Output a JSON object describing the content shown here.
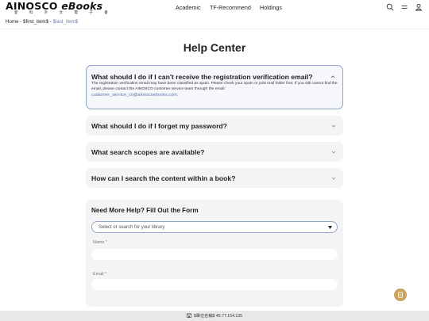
{
  "header": {
    "logo_main": "AINOSCO",
    "logo_ebooks": "eBooks",
    "logo_sub": "愛 科 外 文 電 子 書",
    "nav": [
      "Academic",
      "TF-Recommend",
      "Holdings"
    ],
    "icons": [
      "search-icon",
      "menu-icon",
      "user-icon"
    ]
  },
  "breadcrumb": {
    "home": "Home",
    "item1": "$first_item$",
    "item2": "$last_item$",
    "separator": "-"
  },
  "page_title": "Help Center",
  "faq": [
    {
      "question": "What should I do if I can't receive the registration verification email?",
      "expanded": true,
      "answer": "The registration verification email may have been classified as spam. Please check your spam or junk mail folder first. If you still cannot find the email, please contact the AINOSCO customer service team through the email:",
      "email": "customer_service_cn@ainoscoebooks.com."
    },
    {
      "question": "What should I do if I forget my password?",
      "expanded": false
    },
    {
      "question": "What search scopes are available?",
      "expanded": false
    },
    {
      "question": "How can I search the content within a book?",
      "expanded": false
    }
  ],
  "form": {
    "title": "Need More Help? Fill Out the Form",
    "select_placeholder": "Select or search for your library",
    "name_label": "Name",
    "email_label": "Email",
    "required_mark": "*"
  },
  "footer": {
    "text": "$單位名稱$ 45.77.154.135"
  },
  "colors": {
    "accent": "#8fa4c8",
    "link": "#5a73a8",
    "fab": "#c8a25a"
  }
}
